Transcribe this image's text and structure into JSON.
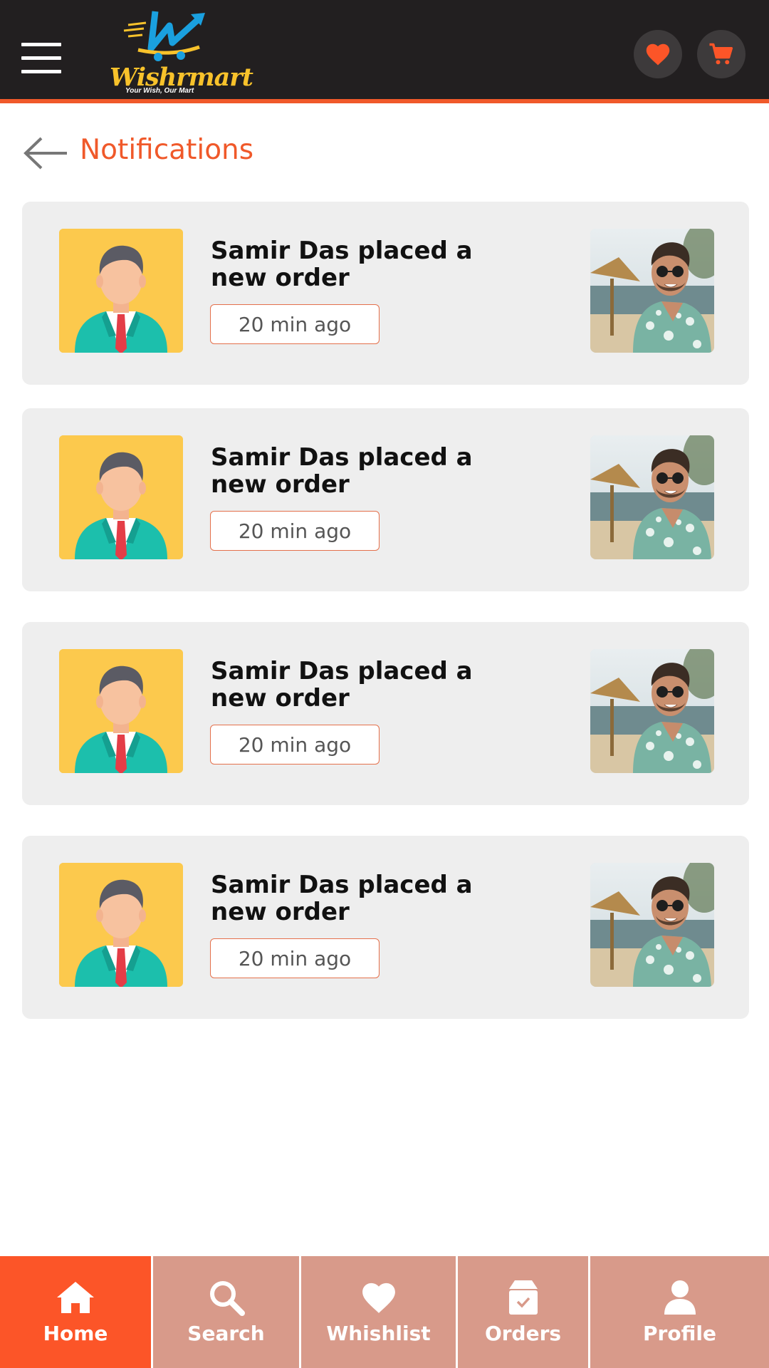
{
  "app": {
    "brand_name": "Wishrmart",
    "brand_tagline": "Your Wish, Our Mart",
    "accent_color": "#f0592a",
    "header_color": "#221f20"
  },
  "header": {
    "menu_icon": "hamburger-menu-icon",
    "wishlist_icon": "heart-icon",
    "cart_icon": "cart-icon"
  },
  "page": {
    "title": "Notifications",
    "back_icon": "arrow-left-icon"
  },
  "notifications": [
    {
      "message": "Samir Das placed a new order",
      "time": "20 min ago"
    },
    {
      "message": "Samir Das placed a new order",
      "time": "20 min ago"
    },
    {
      "message": "Samir Das placed a new order",
      "time": "20 min ago"
    },
    {
      "message": "Samir Das placed a new order",
      "time": "20 min ago"
    }
  ],
  "bottom_nav": [
    {
      "label": "Home",
      "icon": "home-icon",
      "active": true
    },
    {
      "label": "Search",
      "icon": "search-icon",
      "active": false
    },
    {
      "label": "Whishlist",
      "icon": "heart-icon",
      "active": false
    },
    {
      "label": "Orders",
      "icon": "package-icon",
      "active": false
    },
    {
      "label": "Profile",
      "icon": "user-icon",
      "active": false
    }
  ]
}
